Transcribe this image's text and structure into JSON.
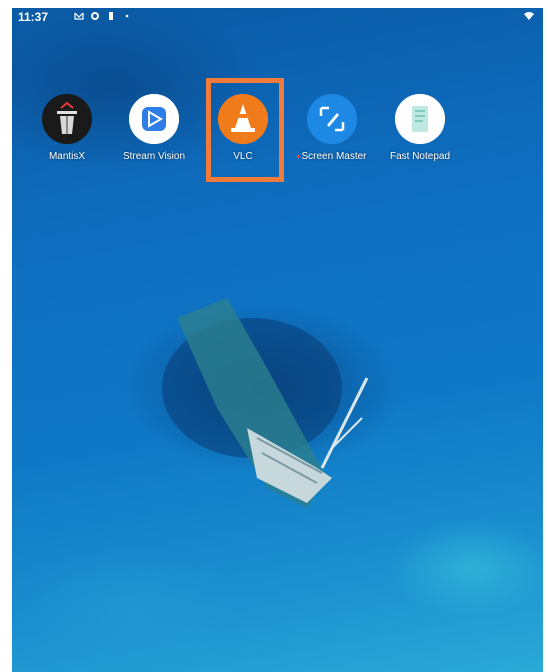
{
  "statusbar": {
    "time": "11:37",
    "left_icons": [
      "gmail-icon",
      "circle-app-icon",
      "battery-icon",
      "dot-icon"
    ],
    "right_icon": "wifi-icon"
  },
  "apps": [
    {
      "label": "MantisX",
      "icon": "mantisx-icon",
      "color": "#111111"
    },
    {
      "label": "Stream Vision",
      "icon": "stream-vision-icon",
      "color": "#ffffff"
    },
    {
      "label": "VLC",
      "icon": "vlc-cone-icon",
      "color": "#f07b1a"
    },
    {
      "label": "Screen Master",
      "icon": "screen-master-icon",
      "color": "#1e88e5",
      "has_new_dot": true
    },
    {
      "label": "Fast Notepad",
      "icon": "fast-notepad-icon",
      "color": "#ffffff"
    }
  ],
  "highlight": {
    "target": "VLC",
    "color": "#f07b3a"
  }
}
